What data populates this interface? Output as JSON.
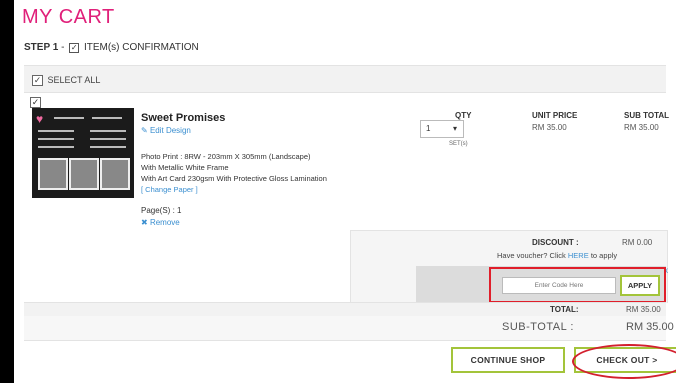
{
  "header": {
    "title": "MY CART"
  },
  "step": {
    "label": "STEP 1",
    "sep": "-",
    "check": "✓",
    "text": "ITEM(s) CONFIRMATION"
  },
  "select_all": {
    "label": "SELECT ALL",
    "checked": true
  },
  "columns": {
    "qty": "QTY",
    "unit_price": "UNIT PRICE",
    "sub_total": "SUB TOTAL"
  },
  "item": {
    "checked": true,
    "name": "Sweet Promises",
    "edit_label": "Edit Design",
    "desc_line1": "Photo Print : 8RW - 203mm X 305mm (Landscape)",
    "desc_line2": "With Metallic White Frame",
    "desc_line3": "With Art Card 230gsm With Protective Gloss Lamination",
    "change_paper": "[ Change Paper ]",
    "pages_label": "Page(S) : 1",
    "remove_label": "Remove",
    "qty_value": "1",
    "qty_unit": "SET(s)",
    "unit_price": "RM 35.00",
    "sub_total": "RM 35.00"
  },
  "summary": {
    "discount_label": "DISCOUNT :",
    "discount_value": "RM 0.00",
    "voucher_prefix": "Have voucher? Click",
    "voucher_link": "HERE",
    "voucher_suffix": "to apply",
    "code_placeholder": "Enter Code Here",
    "apply_label": "APPLY",
    "close_icon": "x",
    "total_label": "TOTAL:",
    "total_value": "RM 35.00",
    "subtotal_label": "SUB-TOTAL :",
    "subtotal_value": "RM 35.00"
  },
  "actions": {
    "continue_label": "CONTINUE SHOP",
    "checkout_label": "CHECK OUT >"
  },
  "colors": {
    "brand_pink": "#e0207a",
    "accent_green": "#a3c43a",
    "highlight_red": "#e01e2a",
    "link_blue": "#3b8fd0"
  }
}
